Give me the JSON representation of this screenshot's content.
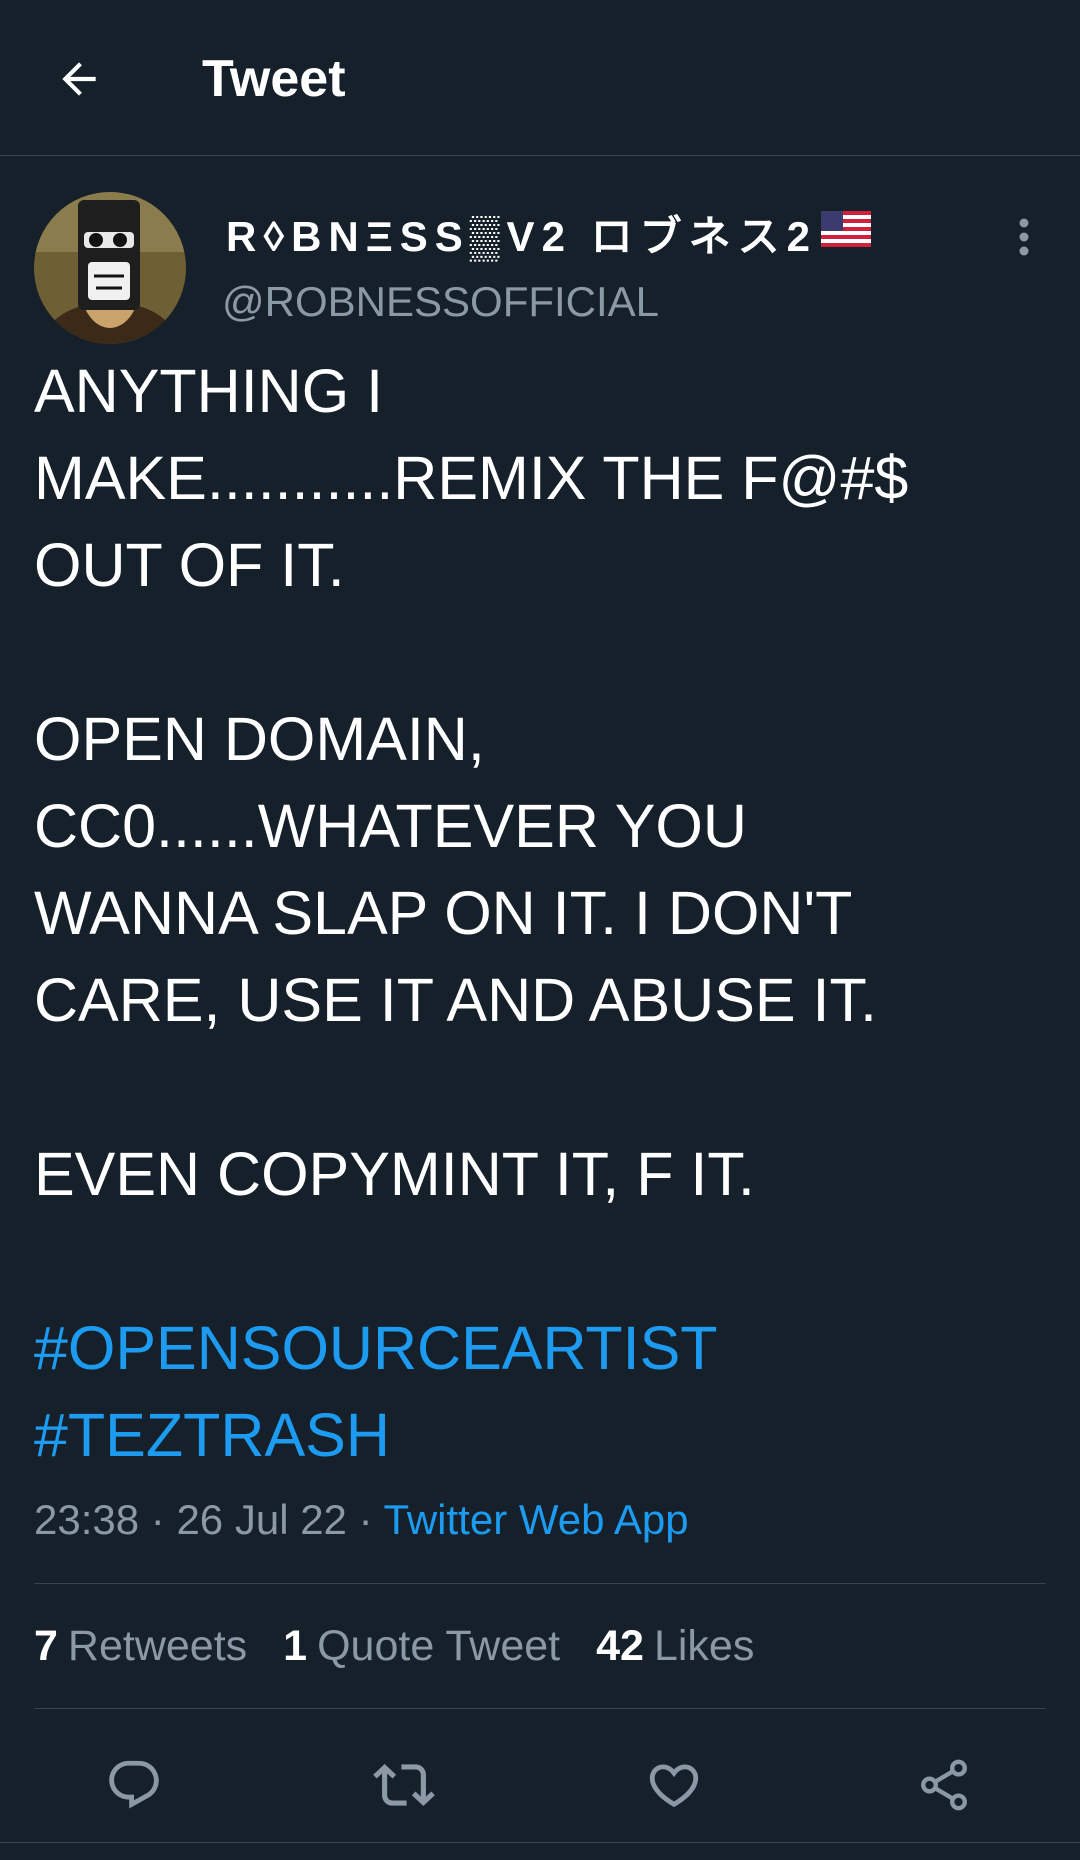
{
  "header": {
    "title": "Tweet",
    "back_icon": "arrow-left-icon"
  },
  "author": {
    "display_name": "R◊BNΞSS▒V2 ロブネス2",
    "flag_icon": "us-flag-icon",
    "handle": "@ROBNESSOFFICIAL",
    "avatar_icon": "avatar-image",
    "more_icon": "more-vertical-icon"
  },
  "tweet": {
    "lines": [
      "ANYTHING I",
      "MAKE...........REMIX THE F@#$",
      "OUT OF IT.",
      "",
      "OPEN DOMAIN,",
      "CC0......WHATEVER YOU",
      "WANNA SLAP ON IT.  I DON'T",
      "CARE, USE IT AND ABUSE IT.",
      "",
      "EVEN COPYMINT IT, F IT.",
      ""
    ],
    "hashtags": [
      "#OPENSOURCEARTIST",
      "#TEZTRASH"
    ],
    "time": "23:38",
    "date": "26 Jul 22",
    "separator": "·",
    "source": "Twitter Web App"
  },
  "stats": {
    "retweets_count": "7",
    "retweets_label": "Retweets",
    "quotes_count": "1",
    "quotes_label": "Quote Tweet",
    "likes_count": "42",
    "likes_label": "Likes"
  },
  "actions": {
    "reply_icon": "reply-icon",
    "retweet_icon": "retweet-icon",
    "like_icon": "heart-icon",
    "share_icon": "share-icon"
  },
  "colors": {
    "background": "#15202b",
    "accent": "#1d9bf0",
    "secondary_text": "#8b98a5",
    "divider": "#38444d"
  }
}
